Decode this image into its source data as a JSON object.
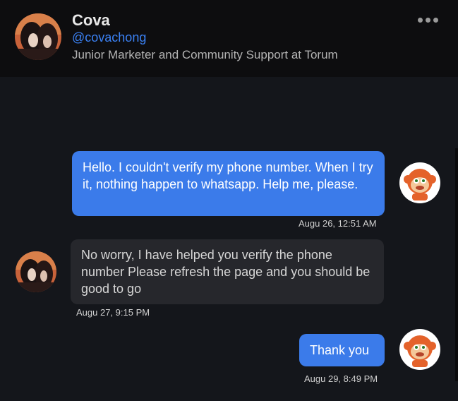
{
  "profile": {
    "name": "Cova",
    "handle": "@covachong",
    "bio": "Junior Marketer and Community Support at Torum"
  },
  "icons": {
    "more": "more-horizontal-icon",
    "user_avatar": "monkey-avatar"
  },
  "colors": {
    "accent": "#3b82f6",
    "outgoing_bubble": "#3b7bea",
    "incoming_bubble": "#26272c",
    "background": "#14161b"
  },
  "messages": [
    {
      "direction": "outgoing",
      "text": "Hello. I couldn't verify my phone number. When I try it, nothing happen to whatsapp. Help me, please.",
      "time": "Augu 26, 12:51 AM"
    },
    {
      "direction": "incoming",
      "text": "No worry, I have helped you verify the phone number Please refresh the page and you should be good to go",
      "time": "Augu 27, 9:15 PM"
    },
    {
      "direction": "outgoing",
      "text": "Thank you",
      "time": "Augu 29, 8:49 PM"
    }
  ]
}
